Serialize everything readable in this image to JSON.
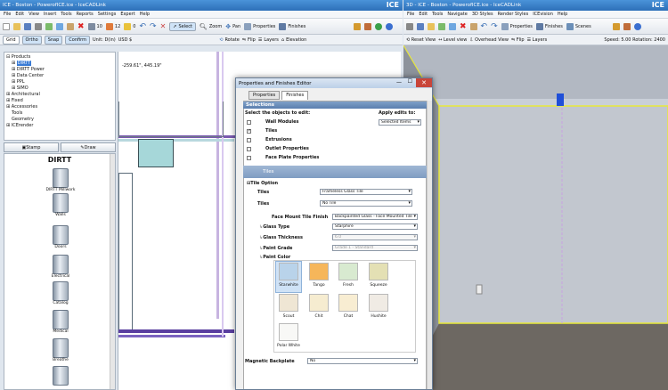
{
  "left_window": {
    "title": "ICE - Boston - PowerofICE.ice - IceCADLink",
    "logo": "ICE",
    "menu": [
      "File",
      "Edit",
      "View",
      "Insert",
      "Tools",
      "Reports",
      "Settings",
      "Expert",
      "Help"
    ],
    "toolbar": {
      "select": "Select",
      "zoom": "Zoom",
      "pan": "Pan",
      "properties": "Properties",
      "finishes": "Finishes",
      "count1": "10",
      "count2": "12",
      "count3": "0"
    },
    "subbar": {
      "grid": "Grid",
      "ortho": "Ortho",
      "snap": "Snap",
      "confirm": "Confirm",
      "unit": "Unit: D(in)",
      "usd": "USD $",
      "rotate": "Rotate",
      "flip": "Flip",
      "layers": "Layers",
      "elevation": "Elevation"
    },
    "tree": [
      "Products",
      "DIRTT",
      "DIRTT Power",
      "Data Center",
      "PPL",
      "SIMO",
      "Architectural",
      "Fixed",
      "Accessories",
      "Tools",
      "Geometry",
      "ICErender"
    ],
    "stamp": "Stamp",
    "draw": "Draw",
    "library": {
      "title": "DIRTT",
      "items": [
        "DIRTT Millwork",
        "Walls",
        "Doors",
        "Electrical",
        "Catalog",
        "Medical",
        "Breathe"
      ]
    },
    "coords": "-259.61\", 445.19\""
  },
  "dialog": {
    "title": "Properties and Finishes Editor",
    "tabs": [
      "Properties",
      "Finishes"
    ],
    "selections_header": "Selections",
    "select_label": "Select the objects to edit:",
    "apply_label": "Apply edits to:",
    "apply_value": "Selected Items",
    "objects": [
      "Wall Modules",
      "Tiles",
      "Extrusions",
      "Outlet Properties",
      "Face Plate Properties"
    ],
    "tiles_header": "Tiles",
    "tile_option": "Tile Option",
    "fields": [
      {
        "label": "Tiles",
        "value": "Frameless Glass Tile"
      },
      {
        "label": "Tiles",
        "value": "No Tile"
      },
      {
        "label": "Face Mount Tile Finish",
        "value": "Backpainted Glass - Face Mounted Tile"
      },
      {
        "label": "Glass Type",
        "value": "Starphire"
      },
      {
        "label": "Glass Thickness",
        "value": "6.0"
      },
      {
        "label": "Paint Grade",
        "value": "Grade 1 - Standard"
      }
    ],
    "paint_color": "Paint Color",
    "colors": [
      {
        "name": "Starwhite",
        "hex": "#b9d3ea"
      },
      {
        "name": "Tango",
        "hex": "#f6b65a"
      },
      {
        "name": "Fresh",
        "hex": "#d8ead0"
      },
      {
        "name": "Squeeze",
        "hex": "#e4e0b4"
      },
      {
        "name": "Scout",
        "hex": "#efe6d4"
      },
      {
        "name": "Chit",
        "hex": "#f6ecd0"
      },
      {
        "name": "Chat",
        "hex": "#f8edd2"
      },
      {
        "name": "Hushite",
        "hex": "#f0ebe4"
      },
      {
        "name": "Polar White",
        "hex": "#f8f8f6"
      }
    ],
    "backplate_label": "Magnetic Backplate",
    "backplate_value": "No"
  },
  "right_window": {
    "title": "3D - ICE - Boston - PowerofICE.ice - IceCADLink",
    "logo": "ICE",
    "menu": [
      "File",
      "Edit",
      "Tools",
      "Navigate",
      "3D Styles",
      "Render Styles",
      "ICEvision",
      "Help"
    ],
    "toolbar": {
      "properties": "Properties",
      "finishes": "Finishes",
      "scenes": "Scenes"
    },
    "subbar": {
      "reset": "Reset View",
      "level": "Level view",
      "overhead": "Overhead View",
      "flip": "Flip",
      "layers": "Layers",
      "speed": "Speed: 5.00 Rotation: 2400"
    }
  }
}
